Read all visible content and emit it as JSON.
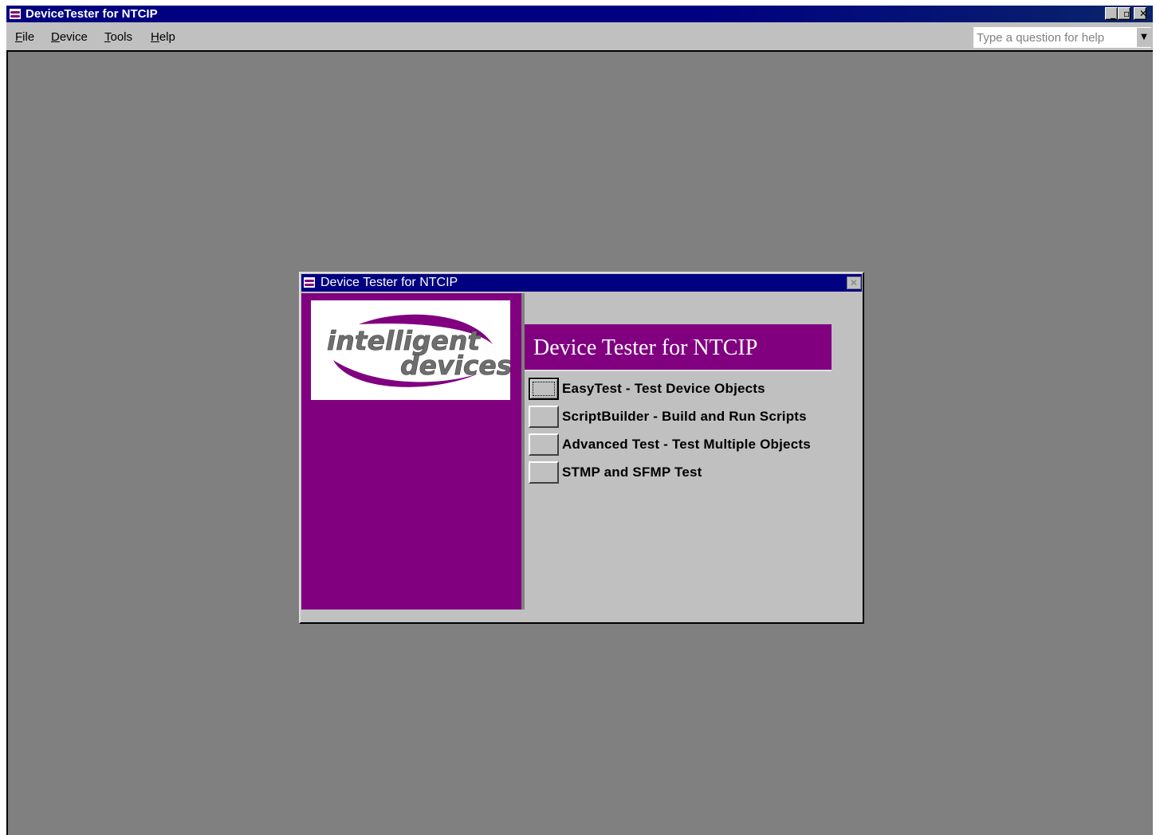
{
  "window": {
    "title": "DeviceTester for NTCIP",
    "controls": {
      "minimize": "_",
      "restore": "▫",
      "close": "✕"
    }
  },
  "menu": {
    "items": [
      {
        "label": "File",
        "mnemonic": "F",
        "rest": "ile"
      },
      {
        "label": "Device",
        "mnemonic": "D",
        "rest": "evice"
      },
      {
        "label": "Tools",
        "mnemonic": "T",
        "rest": "ools"
      },
      {
        "label": "Help",
        "mnemonic": "H",
        "rest": "elp"
      }
    ],
    "help_placeholder": "Type a question for help",
    "help_value": ""
  },
  "dialog": {
    "title": "Device Tester for NTCIP",
    "close_glyph": "✕",
    "logo": {
      "line1": "intelligent",
      "line2": "devices"
    },
    "banner_title": "Device Tester for NTCIP",
    "options": [
      {
        "label": "EasyTest - Test Device Objects",
        "focused": true
      },
      {
        "label": "ScriptBuilder - Build and Run Scripts",
        "focused": false
      },
      {
        "label": "Advanced Test - Test Multiple Objects",
        "focused": false
      },
      {
        "label": "STMP and SFMP Test",
        "focused": false
      }
    ]
  },
  "colors": {
    "brand_purple": "#800080",
    "titlebar_blue": "#000080",
    "workspace_gray": "#808080",
    "face_gray": "#c0c0c0"
  },
  "icons": {
    "app": "ntcip-app-icon",
    "help_dropdown": "chevron-down-icon"
  }
}
